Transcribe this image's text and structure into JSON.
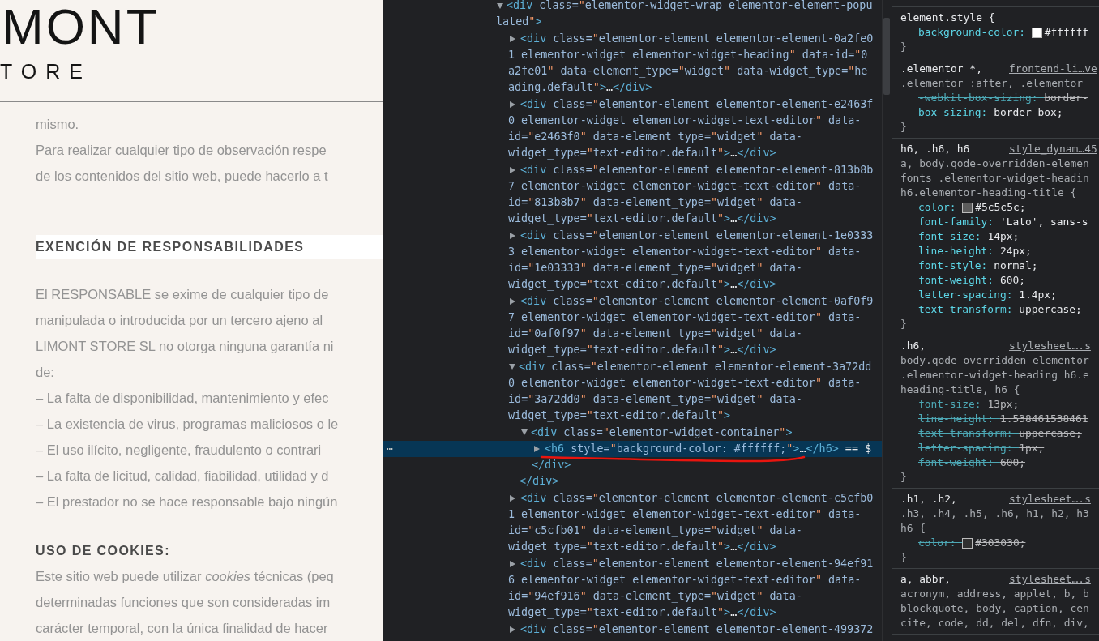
{
  "page": {
    "logo": {
      "title": "MONT",
      "subtitle": "TORE"
    },
    "intro_lines": [
      "mismo.",
      "Para realizar cualquier tipo de observación respe",
      "de los contenidos del sitio web, puede hacerlo a t"
    ],
    "sections": [
      {
        "heading": "EXENCIÓN DE RESPONSABILIDADES",
        "highlighted": true,
        "lines": [
          "El RESPONSABLE  se exime de cualquier tipo de",
          "manipulada o introducida por un tercero ajeno al",
          "LIMONT STORE SL no otorga ninguna garantía ni",
          "de:",
          "– La falta de disponibilidad, mantenimiento y efec",
          "– La existencia de virus, programas maliciosos o le",
          "– El uso ilícito, negligente, fraudulento o contrari",
          "– La falta de licitud, calidad, fiabilidad, utilidad y d",
          "– El prestador no se hace responsable bajo ningún"
        ]
      },
      {
        "heading": "USO DE COOKIES:",
        "highlighted": false,
        "lines": [
          "Este sitio web puede utilizar *cookies* técnicas (peq",
          "determinadas funciones que son consideradas im",
          "carácter temporal, con la única finalidad de hacer"
        ]
      }
    ]
  },
  "elements_tree": {
    "row_menu": "⋯",
    "nodes": [
      {
        "lines": [
          "<div class=\"elementor-widget-wrap elementor-element-popu",
          "lated\">"
        ],
        "expanded": true,
        "selected": false,
        "children": [
          {
            "lines": [
              "<div class=\"elementor-element elementor-element-0a2fe0",
              "1 elementor-widget elementor-widget-heading\" data-id=\"0",
              "a2fe01\" data-element_type=\"widget\" data-widget_type=\"he",
              "ading.default\">…</div>"
            ],
            "expanded": false,
            "selected": false
          },
          {
            "lines": [
              "<div class=\"elementor-element elementor-element-e2463f",
              "0 elementor-widget elementor-widget-text-editor\" data-",
              "id=\"e2463f0\" data-element_type=\"widget\" data-",
              "widget_type=\"text-editor.default\">…</div>"
            ],
            "expanded": false,
            "selected": false
          },
          {
            "lines": [
              "<div class=\"elementor-element elementor-element-813b8b",
              "7 elementor-widget elementor-widget-text-editor\" data-",
              "id=\"813b8b7\" data-element_type=\"widget\" data-",
              "widget_type=\"text-editor.default\">…</div>"
            ],
            "expanded": false,
            "selected": false
          },
          {
            "lines": [
              "<div class=\"elementor-element elementor-element-1e0333",
              "3 elementor-widget elementor-widget-text-editor\" data-",
              "id=\"1e03333\" data-element_type=\"widget\" data-",
              "widget_type=\"text-editor.default\">…</div>"
            ],
            "expanded": false,
            "selected": false
          },
          {
            "lines": [
              "<div class=\"elementor-element elementor-element-0af0f9",
              "7 elementor-widget elementor-widget-text-editor\" data-",
              "id=\"0af0f97\" data-element_type=\"widget\" data-",
              "widget_type=\"text-editor.default\">…</div>"
            ],
            "expanded": false,
            "selected": false
          },
          {
            "lines": [
              "<div class=\"elementor-element elementor-element-3a72dd",
              "0 elementor-widget elementor-widget-text-editor\" data-",
              "id=\"3a72dd0\" data-element_type=\"widget\" data-",
              "widget_type=\"text-editor.default\">"
            ],
            "expanded": true,
            "selected": false,
            "closing": "</div>",
            "children": [
              {
                "lines": [
                  "<div class=\"elementor-widget-container\">"
                ],
                "expanded": true,
                "selected": false,
                "closing": "</div>",
                "children": [
                  {
                    "lines": [
                      "<h6 style=\"background-color: #ffffff;\">…</h6> == $"
                    ],
                    "expanded": false,
                    "selected": true
                  }
                ]
              }
            ]
          },
          {
            "lines": [
              "<div class=\"elementor-element elementor-element-c5cfb0",
              "1 elementor-widget elementor-widget-text-editor\" data-",
              "id=\"c5cfb01\" data-element_type=\"widget\" data-",
              "widget_type=\"text-editor.default\">…</div>"
            ],
            "expanded": false,
            "selected": false
          },
          {
            "lines": [
              "<div class=\"elementor-element elementor-element-94ef91",
              "6 elementor-widget elementor-widget-text-editor\" data-",
              "id=\"94ef916\" data-element_type=\"widget\" data-",
              "widget_type=\"text-editor.default\">…</div>"
            ],
            "expanded": false,
            "selected": false
          },
          {
            "lines": [
              "<div class=\"elementor-element elementor-element-499372"
            ],
            "expanded": false,
            "selected": false
          }
        ]
      }
    ]
  },
  "styles_panel": {
    "rules": [
      {
        "selector_lines": [
          "element.style {"
        ],
        "properties": [
          {
            "name": "background-color:",
            "value": "#ffffff",
            "color": "#ffffff",
            "overridden": false
          }
        ],
        "closing": "}"
      },
      {
        "selector_lines": [
          ".elementor *,",
          ".elementor :after, .elementor"
        ],
        "source": "frontend-li…ve",
        "properties": [
          {
            "name": "-webkit-box-sizing:",
            "value": "border-",
            "overridden": true
          },
          {
            "name": "box-sizing:",
            "value": "border-box;",
            "overridden": false
          }
        ],
        "closing": "}"
      },
      {
        "selector_lines": [
          "h6, .h6, h6",
          "a, body.qode-overridden-elemen",
          "fonts .elementor-widget-headin",
          "h6.elementor-heading-title {"
        ],
        "source": "style_dynam…45",
        "properties": [
          {
            "name": "color:",
            "value": "#5c5c5c;",
            "color": "#5c5c5c",
            "overridden": false
          },
          {
            "name": "font-family:",
            "value": "'Lato', sans-s",
            "overridden": false
          },
          {
            "name": "font-size:",
            "value": "14px;",
            "overridden": false
          },
          {
            "name": "line-height:",
            "value": "24px;",
            "overridden": false
          },
          {
            "name": "font-style:",
            "value": "normal;",
            "overridden": false
          },
          {
            "name": "font-weight:",
            "value": "600;",
            "overridden": false
          },
          {
            "name": "letter-spacing:",
            "value": "1.4px;",
            "overridden": false
          },
          {
            "name": "text-transform:",
            "value": "uppercase;",
            "overridden": false
          }
        ],
        "closing": "}"
      },
      {
        "selector_lines": [
          ".h6,",
          "body.qode-overridden-elementor",
          ".elementor-widget-heading h6.e",
          "heading-title, h6 {"
        ],
        "source": "stylesheet….s",
        "properties": [
          {
            "name": "font-size:",
            "value": "13px;",
            "overridden": true
          },
          {
            "name": "line-height:",
            "value": "1.538461538461",
            "overridden": true
          },
          {
            "name": "text-transform:",
            "value": "uppercase;",
            "overridden": true
          },
          {
            "name": "letter-spacing:",
            "value": "1px;",
            "overridden": true
          },
          {
            "name": "font-weight:",
            "value": "600;",
            "overridden": true
          }
        ],
        "closing": "}"
      },
      {
        "selector_lines": [
          ".h1, .h2,",
          ".h3, .h4, .h5, .h6, h1, h2, h3",
          "h6 {"
        ],
        "source": "stylesheet….s",
        "properties": [
          {
            "name": "color:",
            "value": "#303030;",
            "color": "#303030",
            "overridden": true
          }
        ],
        "closing": "}"
      },
      {
        "selector_lines": [
          "a, abbr,",
          "acronym, address, applet, b, b",
          "blockquote, body, caption, cen",
          "cite, code, dd, del, dfn, div,"
        ],
        "source": "stylesheet….s"
      }
    ]
  }
}
